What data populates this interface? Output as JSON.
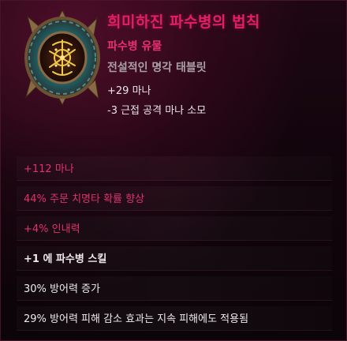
{
  "item": {
    "name": "희미하진 파수병의 법칙",
    "subtype": "파수병 유물",
    "category": "전설적인 명각 태블릿",
    "implicits": [
      "+29 마나",
      "-3 근접 공격 마나 소모"
    ],
    "icon": "tablet-relic-icon"
  },
  "modifiers": [
    {
      "text": "+112 마나",
      "color": "pink"
    },
    {
      "text": "44% 주문 치명타 확률 향상",
      "color": "pink"
    },
    {
      "text": "+4% 인내력",
      "color": "pink"
    },
    {
      "text": "+1 에 파수병 스킬",
      "color": "white"
    },
    {
      "text": "30% 방어력 증가",
      "color": "white"
    },
    {
      "text": "29% 방어력 피해 감소 효과는 지속 피해에도 적용됨",
      "color": "white"
    }
  ],
  "colors": {
    "title": "#e21f64",
    "mod_pink": "#e0316a",
    "mod_white": "#eeeaeb",
    "category": "#a8a0a4"
  }
}
